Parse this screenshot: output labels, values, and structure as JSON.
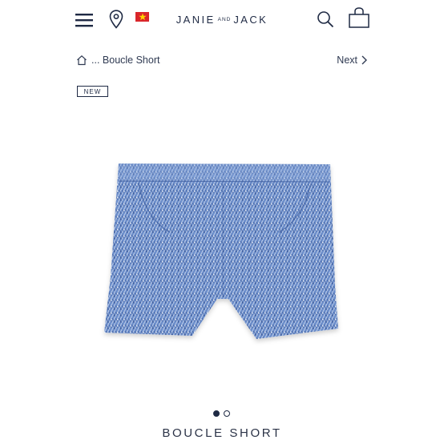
{
  "header": {
    "logo_main": "JANIE",
    "logo_and": "AND",
    "logo_end": "JACK",
    "flag_colors": [
      "#d9262b",
      "#ffd500"
    ]
  },
  "breadcrumb": {
    "ellipsis": "...",
    "current": "Boucle Short"
  },
  "nav": {
    "next_label": "Next"
  },
  "product": {
    "badge": "NEW",
    "title": "BOUCLE SHORT",
    "image_slide": 1,
    "image_count": 2
  },
  "colors": {
    "navy": "#1f2a44",
    "fabric_blue": "#6d8fcb"
  },
  "icons": [
    "hamburger-menu-icon",
    "location-pin-icon",
    "vietnam-flag-icon",
    "search-icon",
    "shopping-bag-icon",
    "home-icon",
    "chevron-right-icon"
  ]
}
